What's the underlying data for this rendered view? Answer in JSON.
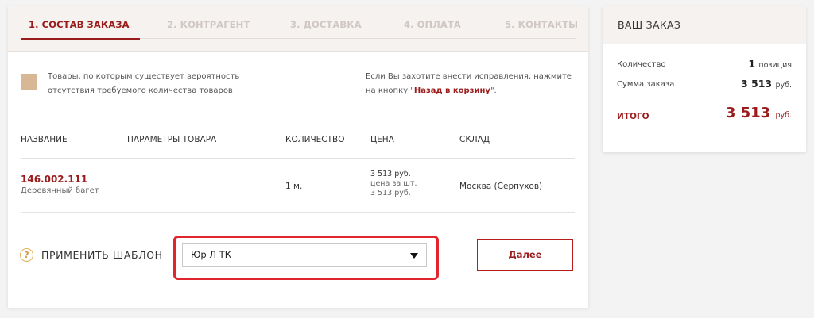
{
  "steps": [
    "1. СОСТАВ ЗАКАЗА",
    "2. КОНТРАГЕНТ",
    "3. ДОСТАВКА",
    "4. ОПЛАТА",
    "5. КОНТАКТЫ"
  ],
  "notice": {
    "left_line1": "Товары, по которым существует вероятность",
    "left_line2": "отсутствия требуемого количества товаров",
    "right_line1": "Если Вы захотите внести исправления, нажмите",
    "right_line2_prefix": "на кнопку \"",
    "right_link": "Назад в корзину",
    "right_line2_suffix": "\"."
  },
  "table": {
    "headers": [
      "НАЗВАНИЕ",
      "ПАРАМЕТРЫ ТОВАРА",
      "КОЛИЧЕСТВО",
      "ЦЕНА",
      "СКЛАД"
    ],
    "row": {
      "code": "146.002.111",
      "name": "Деревянный багет",
      "quantity": "1 м.",
      "price": "3 513 руб.",
      "price_per_label": "цена за шт.",
      "price_per": "3 513 руб.",
      "warehouse": "Москва (Серпухов)"
    }
  },
  "template": {
    "help_icon": "?",
    "label": "ПРИМЕНИТЬ ШАБЛОН",
    "selected": "Юр Л ТК"
  },
  "next_button": "Далее",
  "summary": {
    "title": "ВАШ ЗАКАЗ",
    "qty_label": "Количество",
    "qty_value": "1",
    "qty_unit": "позиция",
    "sum_label": "Сумма заказа",
    "sum_value": "3 513",
    "sum_unit": "руб.",
    "total_label": "итого",
    "total_value": "3 513",
    "total_unit": "руб."
  },
  "colors": {
    "accent": "#9b1c1c",
    "highlight": "#e0262c",
    "swatch": "#d8b796"
  }
}
